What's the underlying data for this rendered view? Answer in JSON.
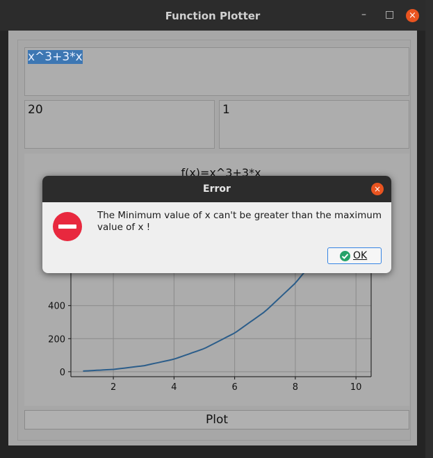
{
  "window": {
    "title": "Function Plotter",
    "minimize_glyph": "–",
    "maximize_glyph": "□",
    "close_glyph": "×"
  },
  "form": {
    "function_value": "x^3+3*x",
    "min_value": "20",
    "max_value": "1",
    "plot_button_label": "Plot"
  },
  "dialog": {
    "title": "Error",
    "message": "The Minimum value of x can't be greater than the maximum value of x !",
    "ok_label": "OK",
    "close_glyph": "×"
  },
  "chart_data": {
    "type": "line",
    "title": "f(x)=x^3+3*x",
    "xlabel": "",
    "ylabel": "",
    "xlim": [
      0.6,
      10.5
    ],
    "ylim": [
      -30,
      1130
    ],
    "x_ticks": [
      2,
      4,
      6,
      8,
      10
    ],
    "y_ticks": [
      0,
      200,
      400
    ],
    "grid": true,
    "series": [
      {
        "x": [
          1,
          2,
          3,
          4,
          5,
          6,
          7,
          8,
          9,
          10
        ],
        "y": [
          4,
          14,
          36,
          76,
          140,
          234,
          364,
          536,
          756,
          1030
        ]
      }
    ],
    "line_color": "#2b5d8a"
  }
}
